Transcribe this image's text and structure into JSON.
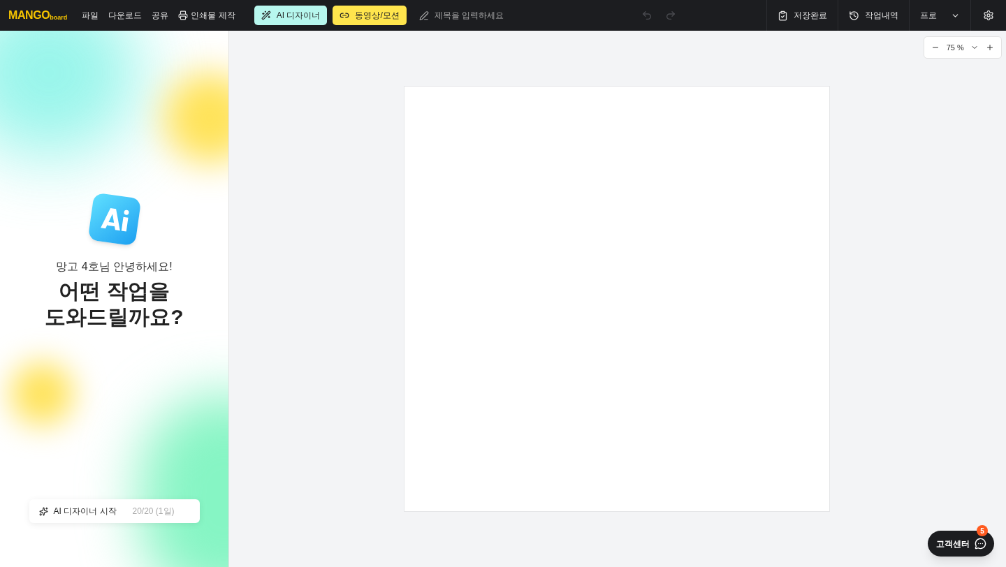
{
  "logo": {
    "main": "MANGO",
    "sub": "board"
  },
  "menu": [
    {
      "kind": "text",
      "label": "파일"
    },
    {
      "kind": "text",
      "label": "다운로드"
    },
    {
      "kind": "text",
      "label": "공유"
    },
    {
      "kind": "print",
      "label": "인쇄물 제작"
    }
  ],
  "mode_buttons": [
    {
      "kind": "ai",
      "label": "AI 디자이너"
    },
    {
      "kind": "video",
      "label": "동영상/모션"
    }
  ],
  "title_field": {
    "placeholder": "제목을 입력하세요"
  },
  "history": [
    {
      "kind": "undo",
      "disabled": true
    },
    {
      "kind": "redo",
      "disabled": true
    }
  ],
  "right_actions": [
    {
      "kind": "save",
      "label": "저장완료"
    },
    {
      "kind": "history",
      "label": "작업내역"
    },
    {
      "kind": "plan",
      "label": "프로"
    }
  ],
  "panel": {
    "greeting": "망고 4호님 안녕하세요!",
    "headline": [
      "어떤 작업을",
      "도와드릴까요?"
    ],
    "start_button": {
      "label": "AI 디자이너 시작",
      "count": "20/20 (1일)"
    }
  },
  "zoom": {
    "value": "75 %"
  },
  "support": {
    "label": "고객센터",
    "badge": "5"
  }
}
